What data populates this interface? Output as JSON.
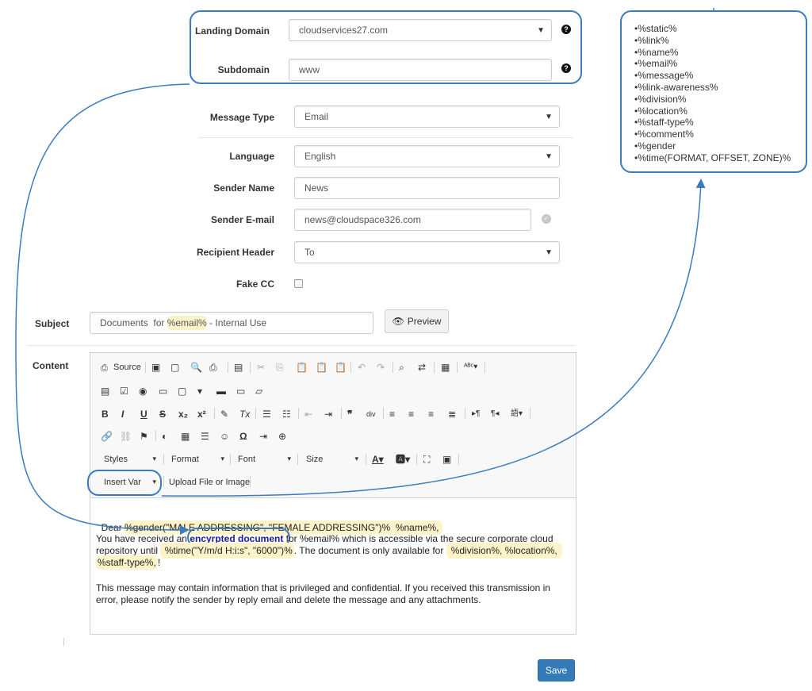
{
  "form": {
    "landing_domain": {
      "label": "Landing Domain",
      "value": "cloudservices27.com"
    },
    "subdomain": {
      "label": "Subdomain",
      "value": "www"
    },
    "message_type": {
      "label": "Message Type",
      "value": "Email"
    },
    "language": {
      "label": "Language",
      "value": "English"
    },
    "sender_name": {
      "label": "Sender Name",
      "value": "News"
    },
    "sender_email": {
      "label": "Sender E-mail",
      "value": "news@cloudspace326.com"
    },
    "recipient_header": {
      "label": "Recipient Header",
      "value": "To"
    },
    "fake_cc": {
      "label": "Fake CC",
      "checked": false
    },
    "subject": {
      "label": "Subject",
      "value_prefix": "Documents  for ",
      "value_var": "%email%",
      "value_suffix": " - Internal Use"
    },
    "preview_button": "Preview",
    "content_label": "Content",
    "save_button": "Save"
  },
  "toolbar": {
    "source_label": "Source",
    "styles_label": "Styles",
    "format_label": "Format",
    "font_label": "Font",
    "size_label": "Size",
    "insert_var_label": "Insert Var",
    "upload_label": "Upload File or Image"
  },
  "editor": {
    "line1_prefix": "Dear ",
    "line1_var": "%gender(\"MALE ADDRESSING\", \"FEMALE ADDRESSING\")%  %name%,",
    "p2_a": "You have received an ",
    "p2_link": "encyrpted document",
    "p2_b": " for %email% which is accessible via the secure corporate cloud",
    "p2_c": "repository until ",
    "p2_time": " %time(\"Y/m/d H:i:s\", \"6000\")%",
    "p2_d": ". The document is only available for ",
    "p2_vars1": "%division%, %location%,",
    "p2_vars2": "%staff-type%,",
    "p2_end": "!",
    "p3_line1": "This message may contain information that is privileged and confidential. If you received this transmission in",
    "p3_line2": "error, please notify the sender by reply email and delete the message and any attachments."
  },
  "variables": [
    "•%static%",
    "•%link%",
    "•%name%",
    "•%email%",
    "•%message%",
    "•%link-awareness%",
    "•%division%",
    "•%location%",
    "•%staff-type%",
    "•%comment%",
    "•%gender",
    "•%time(FORMAT, OFFSET, ZONE)%"
  ],
  "colors": {
    "callout": "#3b7bc0",
    "highlight": "#fdf3c8",
    "save": "#337ab7"
  }
}
